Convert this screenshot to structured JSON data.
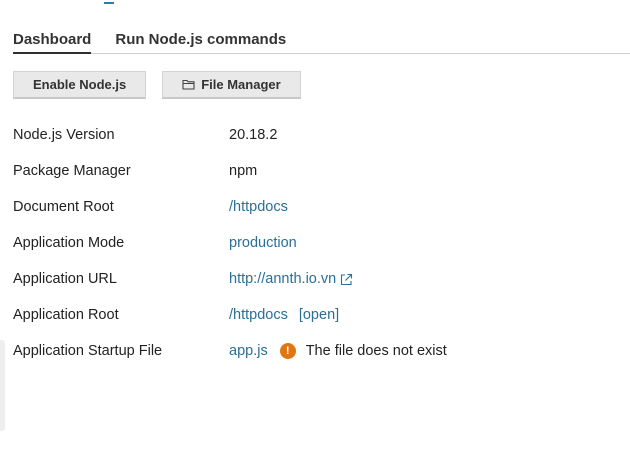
{
  "tabs": [
    {
      "label": "Dashboard",
      "active": true
    },
    {
      "label": "Run Node.js commands",
      "active": false
    }
  ],
  "toolbar": {
    "enable_label": "Enable Node.js",
    "file_manager_label": "File Manager",
    "file_manager_icon": "folder-icon"
  },
  "properties": {
    "nodejs_version": {
      "label": "Node.js Version",
      "value": "20.18.2"
    },
    "package_manager": {
      "label": "Package Manager",
      "value": "npm"
    },
    "document_root": {
      "label": "Document Root",
      "value": "/httpdocs"
    },
    "application_mode": {
      "label": "Application Mode",
      "value": "production"
    },
    "application_url": {
      "label": "Application URL",
      "value": "http://annth.io.vn",
      "icon": "external-link-icon"
    },
    "application_root": {
      "label": "Application Root",
      "value": "/httpdocs",
      "action": "[open]"
    },
    "startup_file": {
      "label": "Application Startup File",
      "value": "app.js",
      "warning_icon": "warning-icon",
      "warning": "The file does not exist"
    }
  },
  "colors": {
    "link": "#2a6f97",
    "warning": "#e07613",
    "accent": "#2c7cb3"
  }
}
